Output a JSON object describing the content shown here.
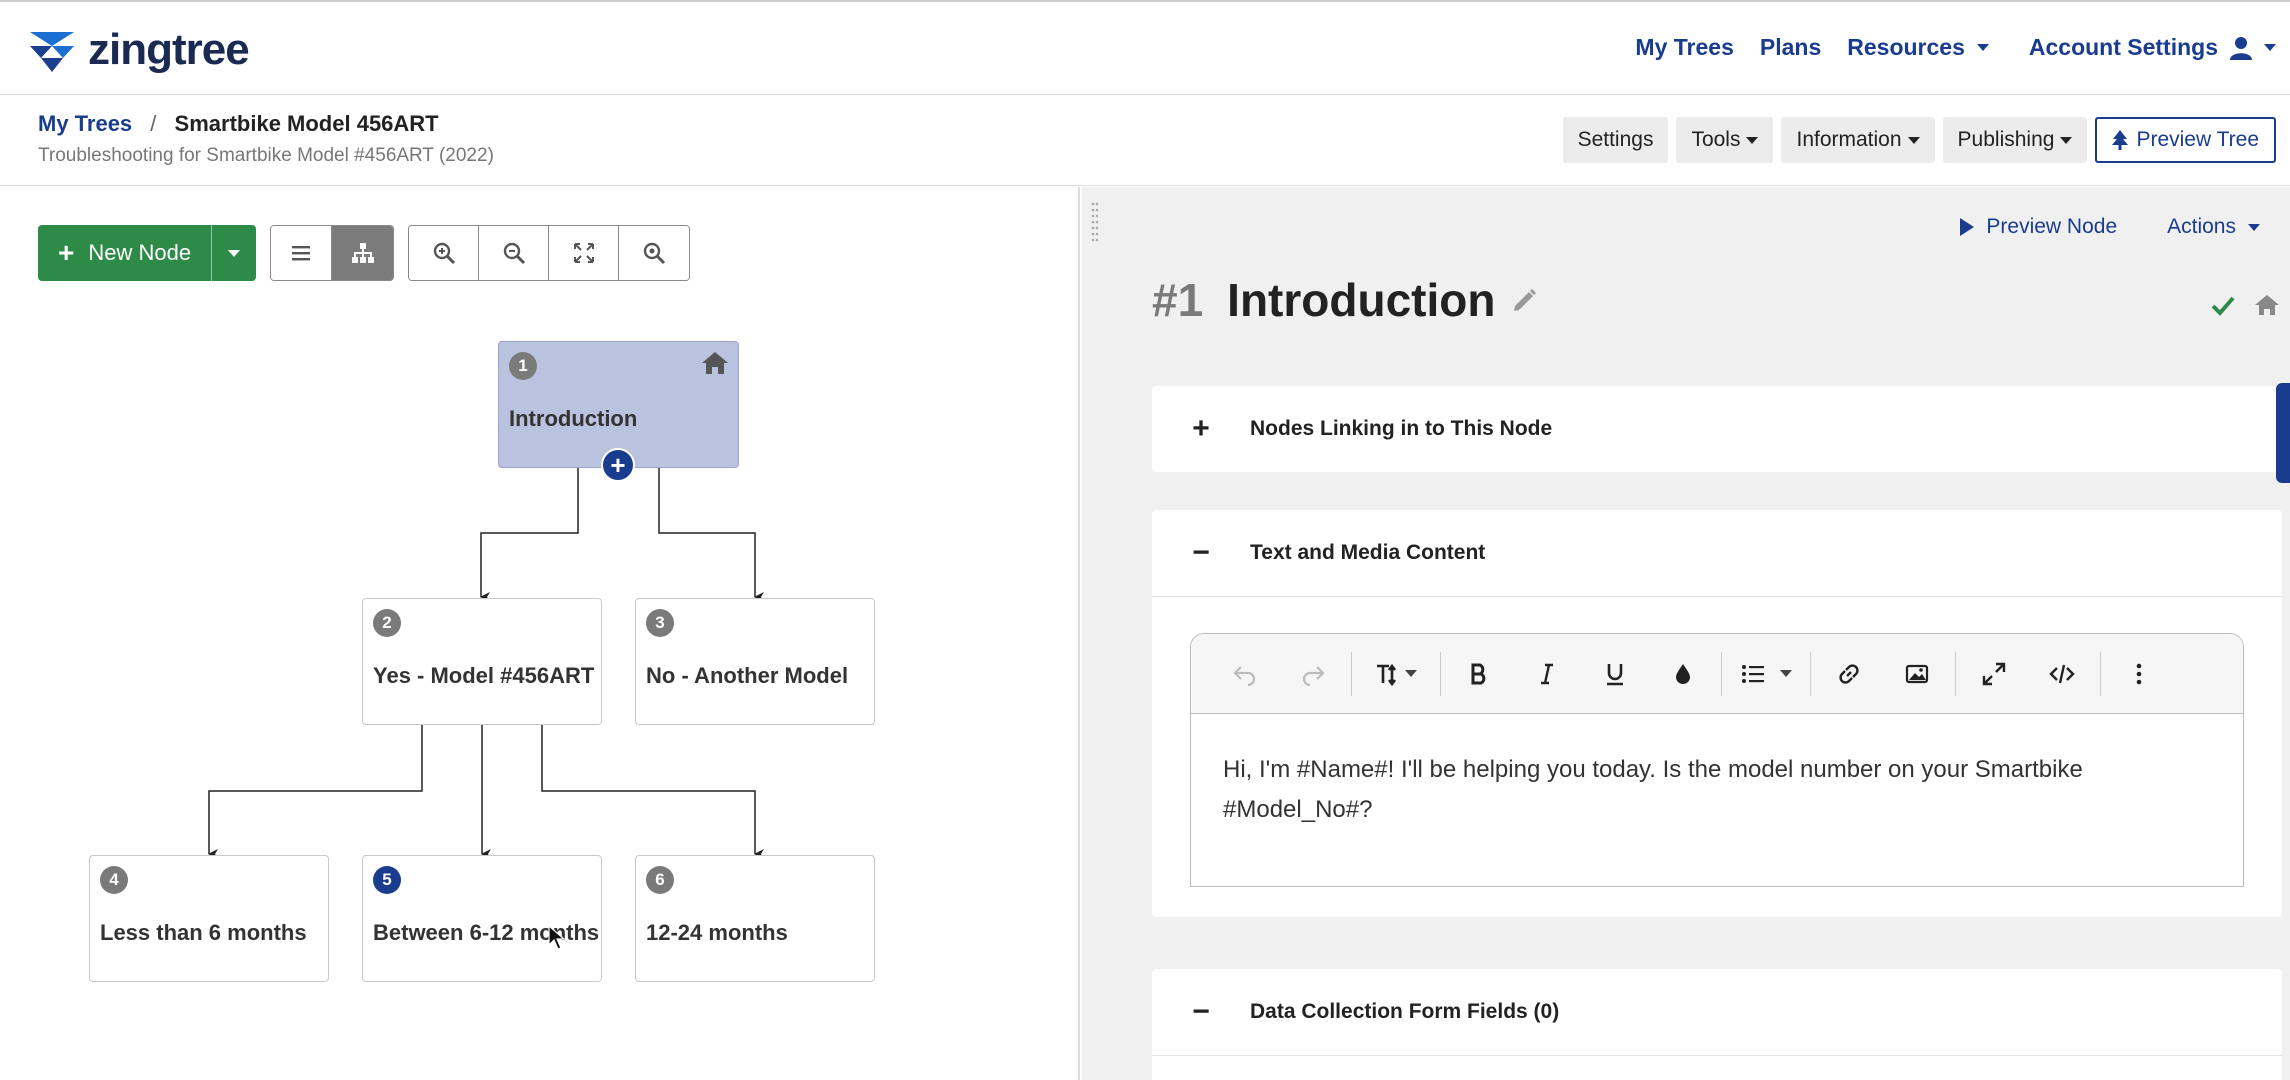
{
  "brand": {
    "name": "zingtree"
  },
  "nav": {
    "my_trees": "My Trees",
    "plans": "Plans",
    "resources": "Resources",
    "account_settings": "Account Settings"
  },
  "breadcrumb": {
    "root": "My Trees",
    "separator": "/",
    "current": "Smartbike Model 456ART"
  },
  "subtitle": "Troubleshooting for Smartbike Model #456ART (2022)",
  "header_tools": {
    "settings": "Settings",
    "tools": "Tools",
    "information": "Information",
    "publishing": "Publishing",
    "preview_tree": "Preview Tree"
  },
  "left_toolbar": {
    "new_node": "New Node",
    "icons": [
      "list-view-icon",
      "tree-view-icon",
      "zoom-in-icon",
      "zoom-out-icon",
      "fit-screen-icon",
      "find-icon"
    ]
  },
  "tree": {
    "nodes": [
      {
        "id": "1",
        "label": "Introduction",
        "selected": true,
        "home": true
      },
      {
        "id": "2",
        "label": "Yes - Model #456ART"
      },
      {
        "id": "3",
        "label": "No - Another Model"
      },
      {
        "id": "4",
        "label": "Less than 6 months"
      },
      {
        "id": "5",
        "label": "Between 6-12 months",
        "badge_color": "#1a3c8f"
      },
      {
        "id": "6",
        "label": "12-24 months"
      }
    ]
  },
  "right_panel": {
    "preview_node": "Preview Node",
    "actions": "Actions",
    "node_number": "#1",
    "node_title": "Introduction",
    "sections": {
      "linking": {
        "symbol": "+",
        "label": "Nodes Linking in to This Node"
      },
      "content": {
        "symbol": "−",
        "label": "Text and Media Content"
      },
      "form": {
        "symbol": "−",
        "label": "Data Collection Form Fields (0)"
      }
    },
    "editor_text": "Hi, I'm #Name#! I'll be helping you today. Is the model number on your Smartbike #Model_No#?",
    "editor_toolbar": [
      "undo-icon",
      "redo-icon",
      "text-size-icon",
      "bold-icon",
      "italic-icon",
      "underline-icon",
      "color-icon",
      "list-icon",
      "link-icon",
      "image-icon",
      "fullscreen-icon",
      "code-icon",
      "more-icon"
    ]
  },
  "colors": {
    "brand_blue": "#1a3c8f",
    "green": "#2e8b47",
    "selected_node": "#b9c2de",
    "check_green": "#2e8b47"
  }
}
